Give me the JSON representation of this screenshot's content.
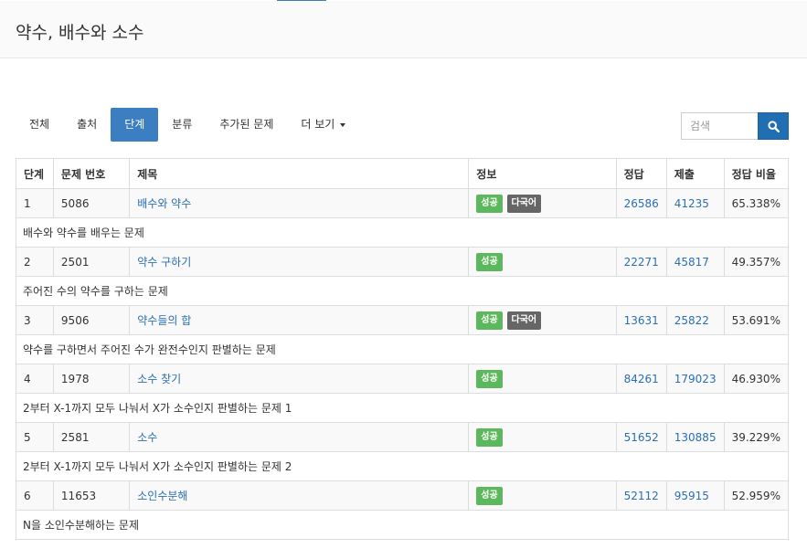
{
  "page": {
    "title": "약수, 배수와 소수"
  },
  "tabs": [
    {
      "label": "전체",
      "active": false
    },
    {
      "label": "출처",
      "active": false
    },
    {
      "label": "단계",
      "active": true
    },
    {
      "label": "분류",
      "active": false
    },
    {
      "label": "추가된 문제",
      "active": false
    },
    {
      "label": "더 보기",
      "active": false
    }
  ],
  "search": {
    "placeholder": "검색",
    "button_icon": "search-icon"
  },
  "table": {
    "headers": [
      "단계",
      "문제 번호",
      "제목",
      "정보",
      "정답",
      "제출",
      "정답 비율"
    ],
    "labels": {
      "success": "성공",
      "multilang": "다국어"
    },
    "rows": [
      {
        "step": "1",
        "id": "5086",
        "title": "배수와 약수",
        "success": true,
        "multilang": true,
        "accepted": "26586",
        "submissions": "41235",
        "ratio": "65.338%",
        "desc": "배수와 약수를 배우는 문제"
      },
      {
        "step": "2",
        "id": "2501",
        "title": "약수 구하기",
        "success": true,
        "multilang": false,
        "accepted": "22271",
        "submissions": "45817",
        "ratio": "49.357%",
        "desc": "주어진 수의 약수를 구하는 문제"
      },
      {
        "step": "3",
        "id": "9506",
        "title": "약수들의 합",
        "success": true,
        "multilang": true,
        "accepted": "13631",
        "submissions": "25822",
        "ratio": "53.691%",
        "desc": "약수를 구하면서 주어진 수가 완전수인지 판별하는 문제"
      },
      {
        "step": "4",
        "id": "1978",
        "title": "소수 찾기",
        "success": true,
        "multilang": false,
        "accepted": "84261",
        "submissions": "179023",
        "ratio": "46.930%",
        "desc": "2부터 X-1까지 모두 나눠서 X가 소수인지 판별하는 문제 1"
      },
      {
        "step": "5",
        "id": "2581",
        "title": "소수",
        "success": true,
        "multilang": false,
        "accepted": "51652",
        "submissions": "130885",
        "ratio": "39.229%",
        "desc": "2부터 X-1까지 모두 나눠서 X가 소수인지 판별하는 문제 2"
      },
      {
        "step": "6",
        "id": "11653",
        "title": "소인수분해",
        "success": true,
        "multilang": false,
        "accepted": "52112",
        "submissions": "95915",
        "ratio": "52.959%",
        "desc": "N을 소인수분해하는 문제"
      }
    ]
  },
  "colors": {
    "accent": "#3b7ec2",
    "link": "#2a6fb3",
    "success": "#5cb85c",
    "multilang": "#666666",
    "search_button": "#1f6fb2"
  }
}
